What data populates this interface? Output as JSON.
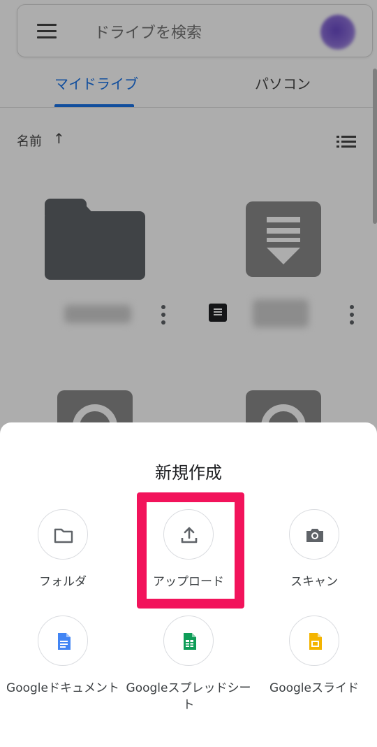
{
  "search": {
    "placeholder": "ドライブを検索"
  },
  "tabs": [
    {
      "label": "マイドライブ",
      "active": true
    },
    {
      "label": "パソコン",
      "active": false
    }
  ],
  "sort": {
    "label": "名前",
    "direction": "↑"
  },
  "colors": {
    "accent": "#1a73e8",
    "highlight": "#f2135b",
    "docs": "#4285f4",
    "sheets": "#0f9d58",
    "slides": "#f4b400"
  },
  "sheet": {
    "title": "新規作成",
    "actions": [
      {
        "label": "フォルダ",
        "icon": "folder-icon"
      },
      {
        "label": "アップロード",
        "icon": "upload-icon"
      },
      {
        "label": "スキャン",
        "icon": "camera-icon"
      },
      {
        "label": "Googleドキュメント",
        "icon": "google-docs-icon"
      },
      {
        "label": "Googleスプレッドシート",
        "icon": "google-sheets-icon"
      },
      {
        "label": "Googleスライド",
        "icon": "google-slides-icon"
      }
    ]
  }
}
